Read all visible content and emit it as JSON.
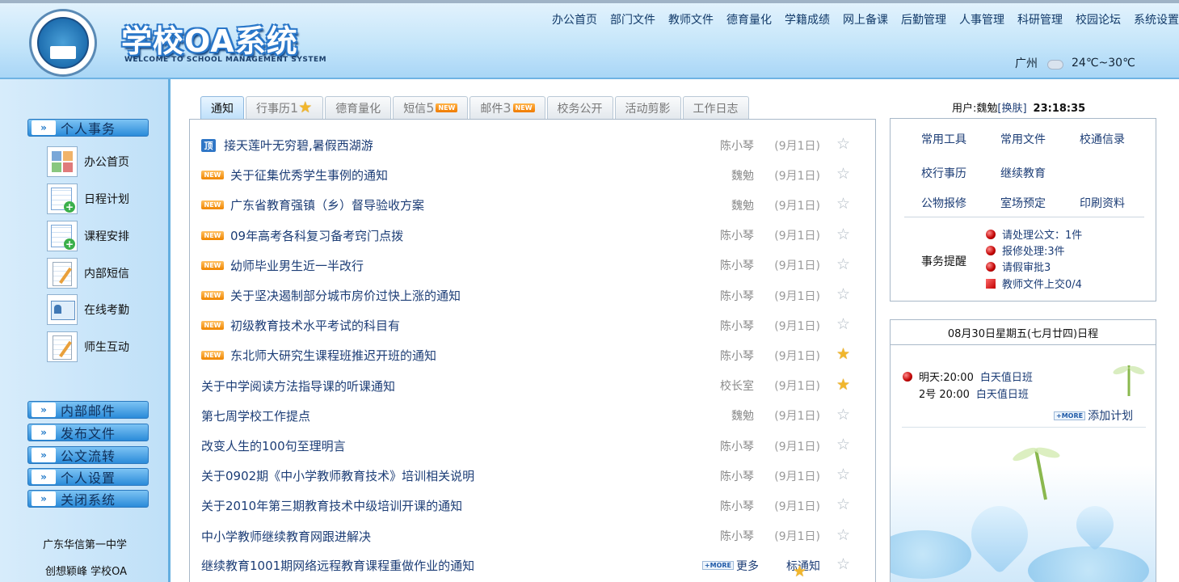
{
  "header": {
    "title": "学校OA系统",
    "subtitle": "WELCOME TO SCHOOL MANAGEMENT SYSTEM",
    "nav": [
      "办公首页",
      "部门文件",
      "教师文件",
      "德育量化",
      "学籍成绩",
      "网上备课",
      "后勤管理",
      "人事管理",
      "科研管理",
      "校园论坛",
      "系统设置"
    ],
    "weather": {
      "city": "广州",
      "temp": "24℃~30℃",
      "icon": "cloud-rain-icon"
    }
  },
  "sidebar": {
    "personal_head": "个人事务",
    "items": [
      {
        "label": "办公首页",
        "icon": "grid"
      },
      {
        "label": "日程计划",
        "icon": "cal"
      },
      {
        "label": "课程安排",
        "icon": "cal"
      },
      {
        "label": "内部短信",
        "icon": "note"
      },
      {
        "label": "在线考勤",
        "icon": "card"
      },
      {
        "label": "师生互动",
        "icon": "note"
      }
    ],
    "heads": [
      "内部邮件",
      "发布文件",
      "公文流转",
      "个人设置",
      "关闭系统"
    ],
    "school_name": "广东华信第一中学",
    "brand": "创想颖峰 学校OA"
  },
  "tabs": [
    {
      "label": "通知",
      "active": true
    },
    {
      "label": "行事历",
      "count": "1",
      "star": true
    },
    {
      "label": "德育量化"
    },
    {
      "label": "短信",
      "count": "5",
      "new": "NEW"
    },
    {
      "label": "邮件",
      "count": "3",
      "new": "NEW"
    },
    {
      "label": "校务公开"
    },
    {
      "label": "活动剪影"
    },
    {
      "label": "工作日志"
    }
  ],
  "notices": [
    {
      "tag": "pin",
      "tag_text": "顶",
      "title": "接天莲叶无穷碧,暑假西湖游",
      "author": "陈小琴",
      "date": "(9月1日)",
      "starred": false
    },
    {
      "tag": "new",
      "tag_text": "NEW",
      "title": "关于征集优秀学生事例的通知",
      "author": "魏勉",
      "date": "(9月1日)",
      "starred": false
    },
    {
      "tag": "new",
      "tag_text": "NEW",
      "title": "广东省教育强镇（乡）督导验收方案",
      "author": "魏勉",
      "date": "(9月1日)",
      "starred": false
    },
    {
      "tag": "new",
      "tag_text": "NEW",
      "title": "09年高考各科复习备考窍门点拨",
      "author": "陈小琴",
      "date": "(9月1日)",
      "starred": false
    },
    {
      "tag": "new",
      "tag_text": "NEW",
      "title": "幼师毕业男生近一半改行",
      "author": "陈小琴",
      "date": "(9月1日)",
      "starred": false
    },
    {
      "tag": "new",
      "tag_text": "NEW",
      "title": "关于坚决遏制部分城市房价过快上涨的通知",
      "author": "陈小琴",
      "date": "(9月1日)",
      "starred": false
    },
    {
      "tag": "new",
      "tag_text": "NEW",
      "title": "初级教育技术水平考试的科目有",
      "author": "陈小琴",
      "date": "(9月1日)",
      "starred": false
    },
    {
      "tag": "new",
      "tag_text": "NEW",
      "title": "东北师大研究生课程班推迟开班的通知",
      "author": "陈小琴",
      "date": "(9月1日)",
      "starred": true
    },
    {
      "tag": "",
      "title": "关于中学阅读方法指导课的听课通知",
      "author": "校长室",
      "date": "(9月1日)",
      "starred": true
    },
    {
      "tag": "",
      "title": "第七周学校工作提点",
      "author": "魏勉",
      "date": "(9月1日)",
      "starred": false
    },
    {
      "tag": "",
      "title": "改变人生的100句至理明言",
      "author": "陈小琴",
      "date": "(9月1日)",
      "starred": false
    },
    {
      "tag": "",
      "title": "关于0902期《中小学教师教育技术》培训相关说明",
      "author": "陈小琴",
      "date": "(9月1日)",
      "starred": false
    },
    {
      "tag": "",
      "title": "关于2010年第三期教育技术中级培训开课的通知",
      "author": "陈小琴",
      "date": "(9月1日)",
      "starred": false
    },
    {
      "tag": "",
      "title": "中小学教师继续教育网跟进解决",
      "author": "陈小琴",
      "date": "(9月1日)",
      "starred": false
    }
  ],
  "last_row": {
    "title": "继续教育1001期网络远程教育课程重做作业的通知",
    "more_tag": "+MORE",
    "more_label": "更多",
    "legend_pre": "标",
    "legend_post": "通知"
  },
  "user": {
    "label": "用户:魏勉",
    "skin": "[换肤]",
    "clock": "23:18:35"
  },
  "tools": {
    "links": [
      "常用工具",
      "常用文件",
      "校通信录",
      "校行事历",
      "继续教育",
      "公物报修",
      "室场预定",
      "印刷资料"
    ],
    "reminder_label": "事务提醒",
    "reminders": [
      "请处理公文：1件",
      "报修处理:3件",
      "请假审批3",
      "教师文件上交0/4"
    ]
  },
  "schedule": {
    "header": "08月30日星期五(七月廿四)日程",
    "entries": [
      {
        "day": "明天:20:00",
        "plan": "白天值日班"
      },
      {
        "day": "2号  20:00",
        "plan": "白天值日班"
      }
    ],
    "more_tag": "+MORE",
    "add_label": "添加计划"
  }
}
